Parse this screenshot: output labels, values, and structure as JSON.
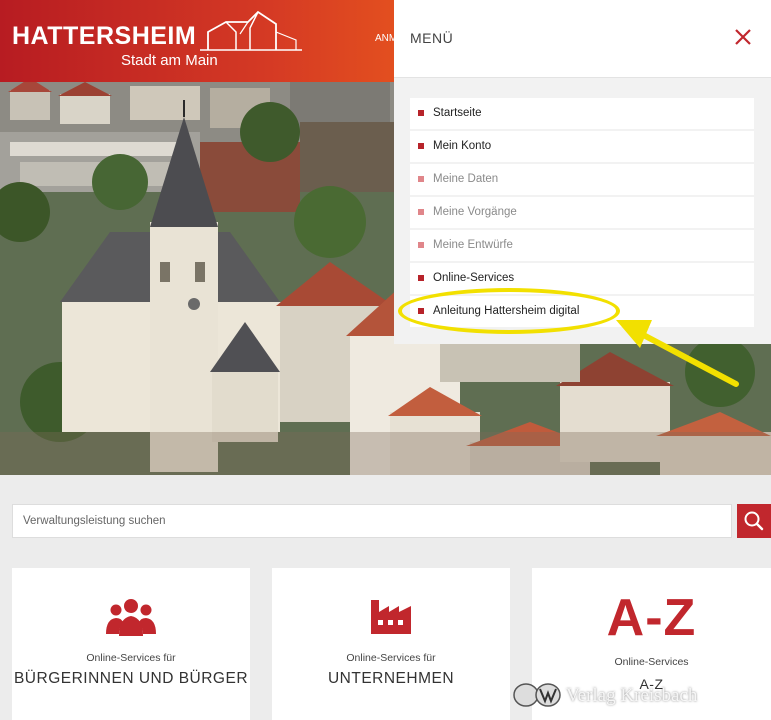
{
  "header": {
    "logo_title": "HATTERSHEIM",
    "logo_subtitle": "Stadt am Main",
    "nav_partial": "ANM"
  },
  "menu": {
    "title": "MENÜ",
    "items": [
      {
        "label": "Startseite",
        "muted": false
      },
      {
        "label": "Mein Konto",
        "muted": false
      },
      {
        "label": "Meine Daten",
        "muted": true
      },
      {
        "label": "Meine Vorgänge",
        "muted": true
      },
      {
        "label": "Meine Entwürfe",
        "muted": true
      },
      {
        "label": "Online-Services",
        "muted": false
      },
      {
        "label": "Anleitung Hattersheim digital",
        "muted": false
      }
    ]
  },
  "search": {
    "placeholder": "Verwaltungsleistung suchen"
  },
  "cards": [
    {
      "sub": "Online-Services für",
      "main": "BÜRGERINNEN UND BÜRGER",
      "icon": "people-icon"
    },
    {
      "sub": "Online-Services für",
      "main": "UNTERNEHMEN",
      "icon": "factory-icon"
    },
    {
      "big": "A-Z",
      "sub": "Online-Services",
      "main": "A-Z",
      "icon": "az-text"
    }
  ],
  "watermark": "Verlag Kreisbach",
  "colors": {
    "accent": "#c1272d",
    "highlight": "#f2e000",
    "header_left": "#b71c22",
    "header_right": "#ef6a1a"
  }
}
